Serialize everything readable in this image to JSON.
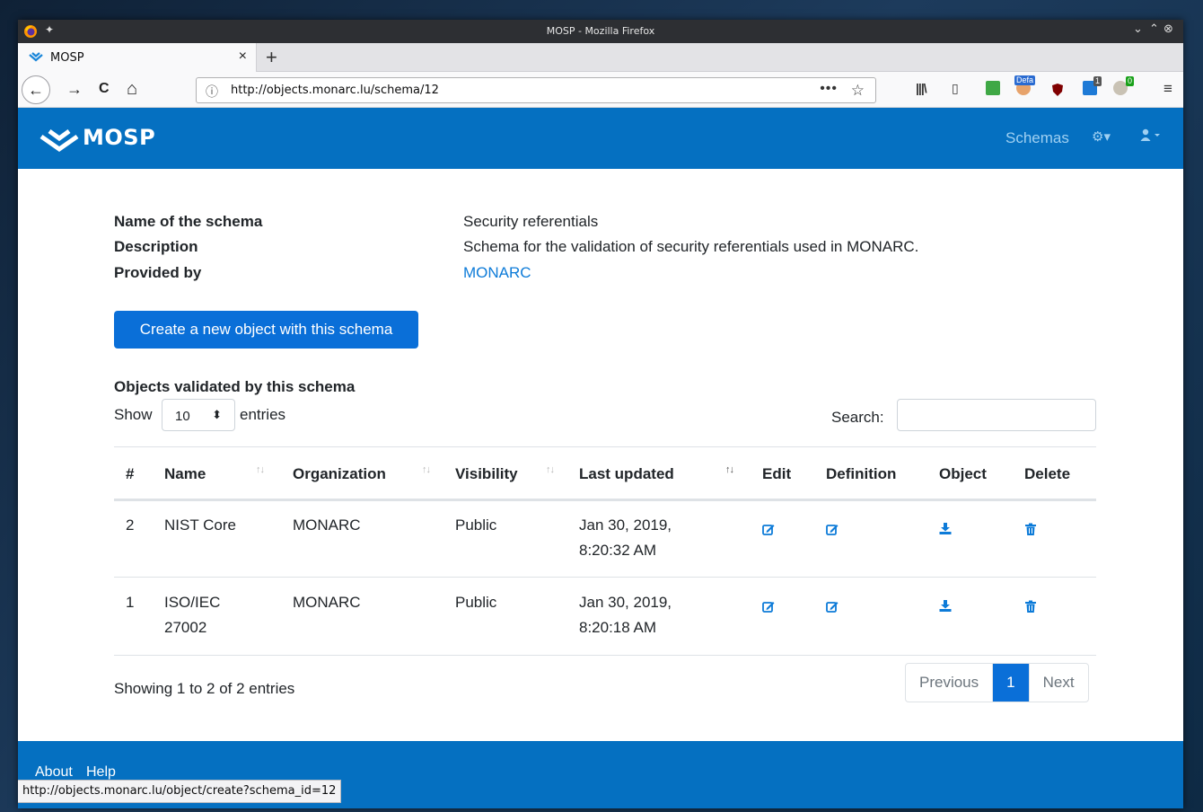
{
  "os": {
    "window_title": "MOSP - Mozilla Firefox",
    "controls": {
      "minimize": "⌄",
      "maximize": "⌃",
      "close": "⊗"
    }
  },
  "browser": {
    "tab": {
      "title": "MOSP",
      "close": "×"
    },
    "new_tab": "+",
    "nav": {
      "back": "←",
      "forward": "→",
      "reload": "C",
      "home": "⌂"
    },
    "url": "http://objects.monarc.lu/schema/12",
    "page_actions": {
      "more": "•••",
      "bookmark": "☆"
    },
    "toolbar": {
      "library": "\\",
      "sidebar": "▯",
      "ext_badge_defa": "Defa",
      "ext_badge_1": "1",
      "ext_badge_0": "0",
      "menu": "≡"
    },
    "status_url": "http://objects.monarc.lu/object/create?schema_id=12"
  },
  "site": {
    "brand": "MOSP",
    "brand_color": "#0570c1",
    "nav": {
      "schemas": "Schemas",
      "settings_icon": "⚙▾",
      "user_icon": "▴▾"
    }
  },
  "schema": {
    "name_label": "Name of the schema",
    "name_value": "Security referentials",
    "description_label": "Description",
    "description_value": "Schema for the validation of security referentials used in MONARC.",
    "provided_label": "Provided by",
    "provided_value": "MONARC",
    "create_button": "Create a new object with this schema"
  },
  "objects": {
    "section_title": "Objects validated by this schema",
    "show_label": "Show",
    "page_size": "10",
    "page_size_arrow": "⬍",
    "entries_label": "entries",
    "search_label": "Search:",
    "headers": {
      "id": "#",
      "name": "Name",
      "organization": "Organization",
      "visibility": "Visibility",
      "last_updated": "Last updated",
      "edit": "Edit",
      "definition": "Definition",
      "object": "Object",
      "delete": "Delete"
    },
    "sort_glyph": "↑↓",
    "rows": [
      {
        "id": "2",
        "name_l1": "NIST Core",
        "name_l2": "",
        "organization": "MONARC",
        "visibility": "Public",
        "updated_l1": "Jan 30, 2019,",
        "updated_l2": "8:20:32 AM"
      },
      {
        "id": "1",
        "name_l1": "ISO/IEC",
        "name_l2": "27002",
        "organization": "MONARC",
        "visibility": "Public",
        "updated_l1": "Jan 30, 2019,",
        "updated_l2": "8:20:18 AM"
      }
    ],
    "info": "Showing 1 to 2 of 2 entries",
    "pagination": {
      "previous": "Previous",
      "current": "1",
      "next": "Next"
    }
  },
  "footer": {
    "about": "About",
    "help": "Help"
  }
}
